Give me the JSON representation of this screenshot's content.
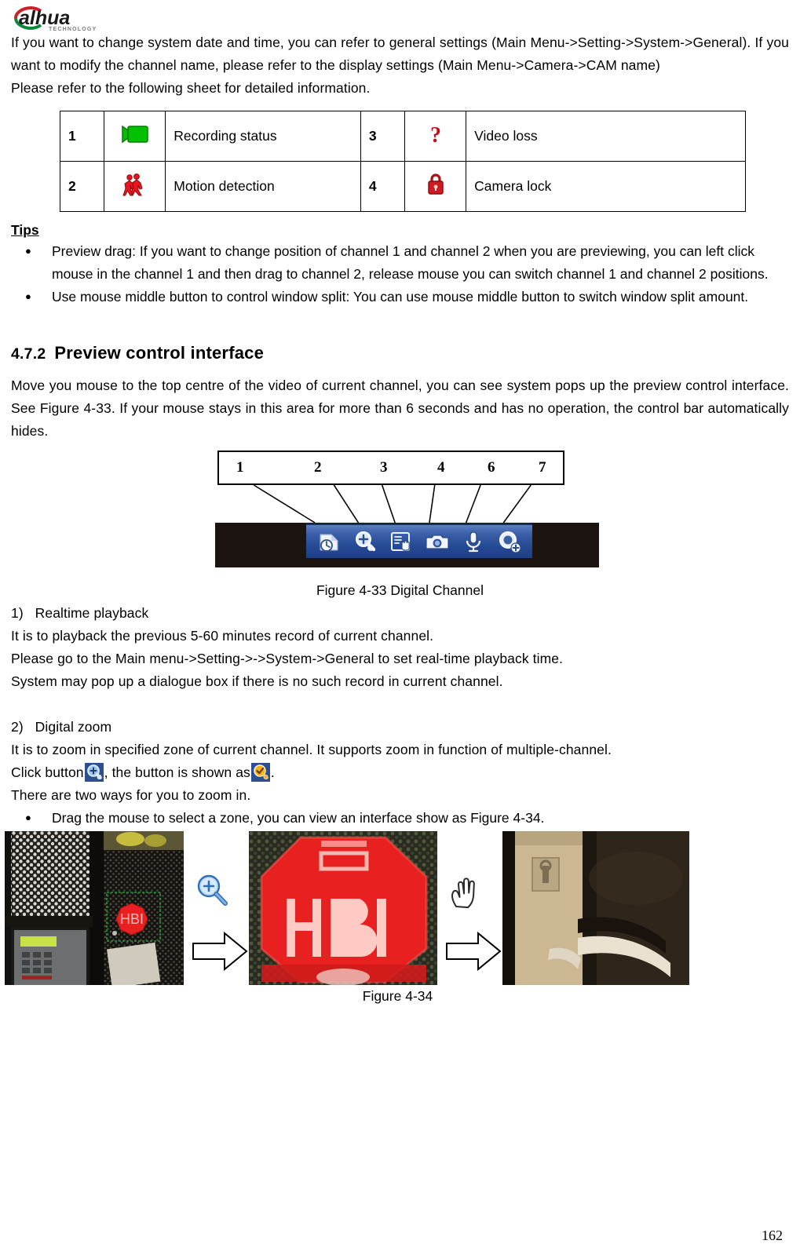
{
  "logo": {
    "brand": "alhua",
    "tagline": "TECHNOLOGY"
  },
  "intro": {
    "paragraph1": "If you want to change system date and time, you can refer to general settings (Main Menu->Setting->System->General). If you want to modify the channel name, please refer to the display settings (Main Menu->Camera->CAM name)",
    "paragraph2": "Please refer to the following sheet for detailed information."
  },
  "legend_table": {
    "rows": [
      {
        "left_num": "1",
        "left_icon": "recording-status-camcorder-icon",
        "left_label": "Recording status",
        "right_num": "3",
        "right_icon": "video-loss-question-mark-icon",
        "right_label": "Video loss"
      },
      {
        "left_num": "2",
        "left_icon": "motion-detection-running-person-icon",
        "left_label": "Motion detection",
        "right_num": "4",
        "right_icon": "camera-lock-padlock-icon",
        "right_label": "Camera lock"
      }
    ]
  },
  "tips": {
    "title": "Tips",
    "items": [
      "Preview drag: If you want to change position of channel 1 and channel 2 when you are previewing, you can left click mouse in the channel 1 and then drag to channel 2, release mouse you can switch channel 1 and channel 2 positions.",
      "Use mouse middle button to control window split: You can use mouse middle button to switch window split amount."
    ]
  },
  "section": {
    "number": "4.7.2",
    "title": "Preview control interface",
    "body": "Move you mouse to the top centre of the video of current channel, you can see system pops up the preview control interface. See Figure 4-33. If your mouse stays in this area for more than 6 seconds and has no operation, the control bar automatically hides."
  },
  "figure_433": {
    "callout_numbers": [
      "1",
      "2",
      "3",
      "4",
      "6",
      "7"
    ],
    "toolbar_icons": [
      "realtime-playback-icon",
      "digital-zoom-icon",
      "manual-record-icon",
      "snapshot-camera-icon",
      "audio-microphone-icon",
      "remote-device-add-icon"
    ],
    "caption": "Figure 4-33 Digital Channel"
  },
  "numbered_items": {
    "item1_label": "1)",
    "item1_title": "Realtime playback",
    "item1_line1": "It is to playback the previous 5-60 minutes record of current channel.",
    "item1_line2": "Please go to the Main menu->Setting->->System->General to set real-time playback time.",
    "item1_line3": "System may pop up a dialogue box if there is no such record in current channel.",
    "item2_label": "2)",
    "item2_title": "Digital zoom",
    "item2_line1": "It is to zoom in specified zone of current channel. It supports zoom in function of multiple-channel.",
    "item2_click_prefix": "Click button",
    "item2_click_mid": ", the button is shown as",
    "item2_click_suffix": ".",
    "item2_icon_normal": "zoom-in-magnifier-blue-icon",
    "item2_icon_active": "zoom-confirm-magnifier-orange-icon",
    "item2_line2": "There are two ways for you to zoom in.",
    "item2_bullet1": "Drag the mouse to select a zone, you can view an interface show as Figure 4-34."
  },
  "figure_434": {
    "shot1_alt": "camera-view-with-green-selection-box-on-hbi-sign",
    "shot2_alt": "zoomed-hbi-red-octagon-sign",
    "shot3_alt": "zoomed-door-handle-detail",
    "tool_icon_1": "zoom-in-magnifier-icon",
    "tool_icon_2": "pan-hand-icon",
    "arrow_icon": "block-right-arrow-icon",
    "caption": "Figure 4-34",
    "sign_text": "HBI"
  },
  "footer": {
    "page_number": "162"
  },
  "colors": {
    "recording_green": "#00c000",
    "alert_red": "#cc0000",
    "toolbar_blue": "#2b52a0",
    "selection_green": "#1f9b2f",
    "sign_red": "#e8201f"
  }
}
